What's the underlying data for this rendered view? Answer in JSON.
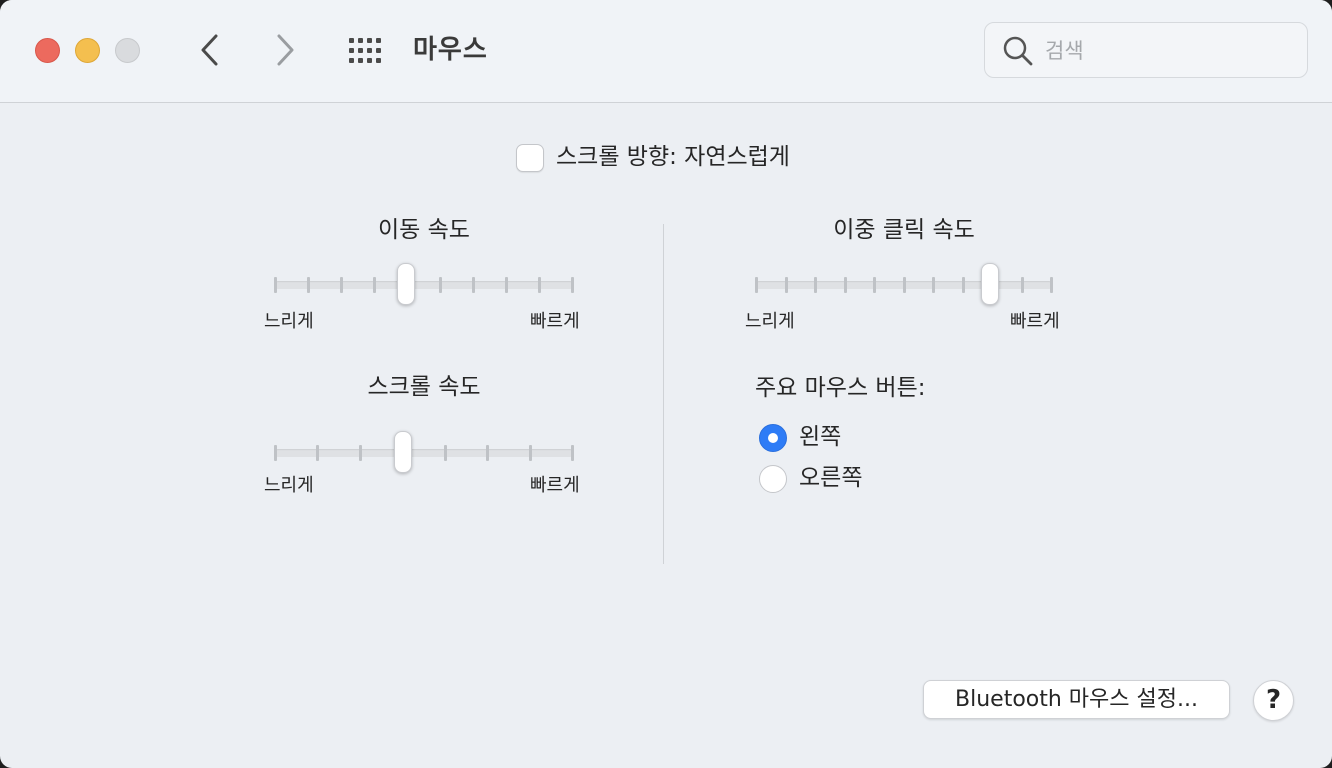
{
  "window": {
    "title": "마우스",
    "search_placeholder": "검색"
  },
  "toolbar": {
    "icons": [
      "close-light",
      "minimize-light",
      "zoom-light",
      "chevron-left-icon",
      "chevron-right-icon",
      "grid-icon",
      "search-icon"
    ]
  },
  "scroll_direction": {
    "label": "스크롤 방향: 자연스럽게",
    "checked": false
  },
  "tracking_speed": {
    "title": "이동 속도",
    "min_label": "느리게",
    "max_label": "빠르게",
    "tick_count": 10,
    "value_fraction": 0.44
  },
  "scroll_speed": {
    "title": "스크롤 속도",
    "min_label": "느리게",
    "max_label": "빠르게",
    "tick_count": 8,
    "value_fraction": 0.43
  },
  "double_click_speed": {
    "title": "이중 클릭 속도",
    "min_label": "느리게",
    "max_label": "빠르게",
    "tick_count": 11,
    "value_fraction": 0.79
  },
  "primary_button": {
    "title": "주요 마우스 버튼:",
    "options": [
      {
        "label": "왼쪽",
        "selected": true
      },
      {
        "label": "오른쪽",
        "selected": false
      }
    ]
  },
  "footer": {
    "bluetooth_button": "Bluetooth 마우스 설정...",
    "help_button": "?"
  },
  "colors": {
    "accent": "#2e7cf6",
    "close": "#ec6a5e",
    "minimize": "#f4bf4f",
    "zoom_inactive": "#d9dbde"
  }
}
